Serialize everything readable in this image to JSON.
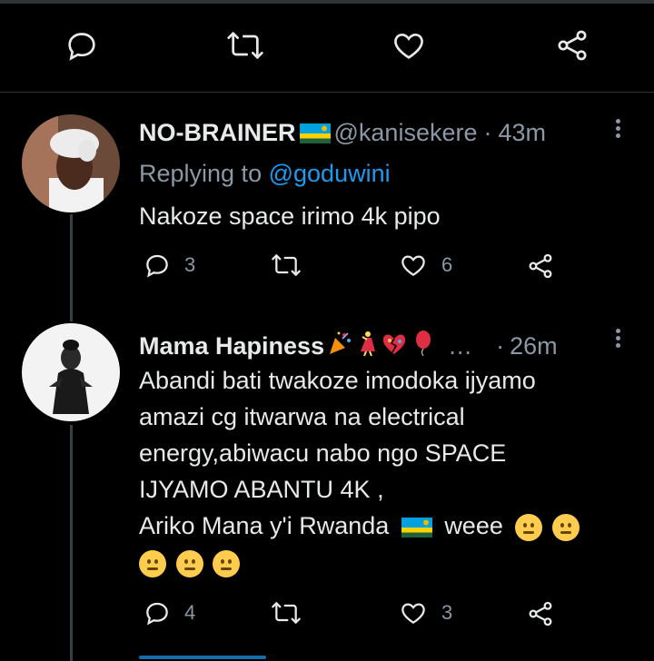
{
  "top_actions": {
    "reply_label": "",
    "retweet_label": "",
    "like_label": "",
    "share_label": ""
  },
  "tweets": [
    {
      "display_name": "NO-BRAINER",
      "handle": "@kanisekere",
      "separator": "·",
      "time": "43m",
      "replying_prefix": "Replying to",
      "replying_to": "@goduwini",
      "text_lines": [
        "Nakoze space irimo 4k pipo"
      ],
      "reply_count": "3",
      "retweet_count": "",
      "like_count": "6"
    },
    {
      "display_name": "Mama Hapiness",
      "ellipsis": "…",
      "separator": "·",
      "time": "26m",
      "text_lines": [
        "Abandi bati twakoze imodoka ijyamo",
        "amazi cg itwarwa na electrical",
        "energy,abiwacu nabo ngo SPACE",
        "IJYAMO ABANTU 4K ,",
        "Ariko Mana y'i Rwanda",
        "weee"
      ],
      "reply_count": "4",
      "retweet_count": "",
      "like_count": "3"
    }
  ],
  "colors": {
    "background": "#000000",
    "text": "#e7e9ea",
    "muted": "#8b98a5",
    "link": "#1d9bf0"
  }
}
